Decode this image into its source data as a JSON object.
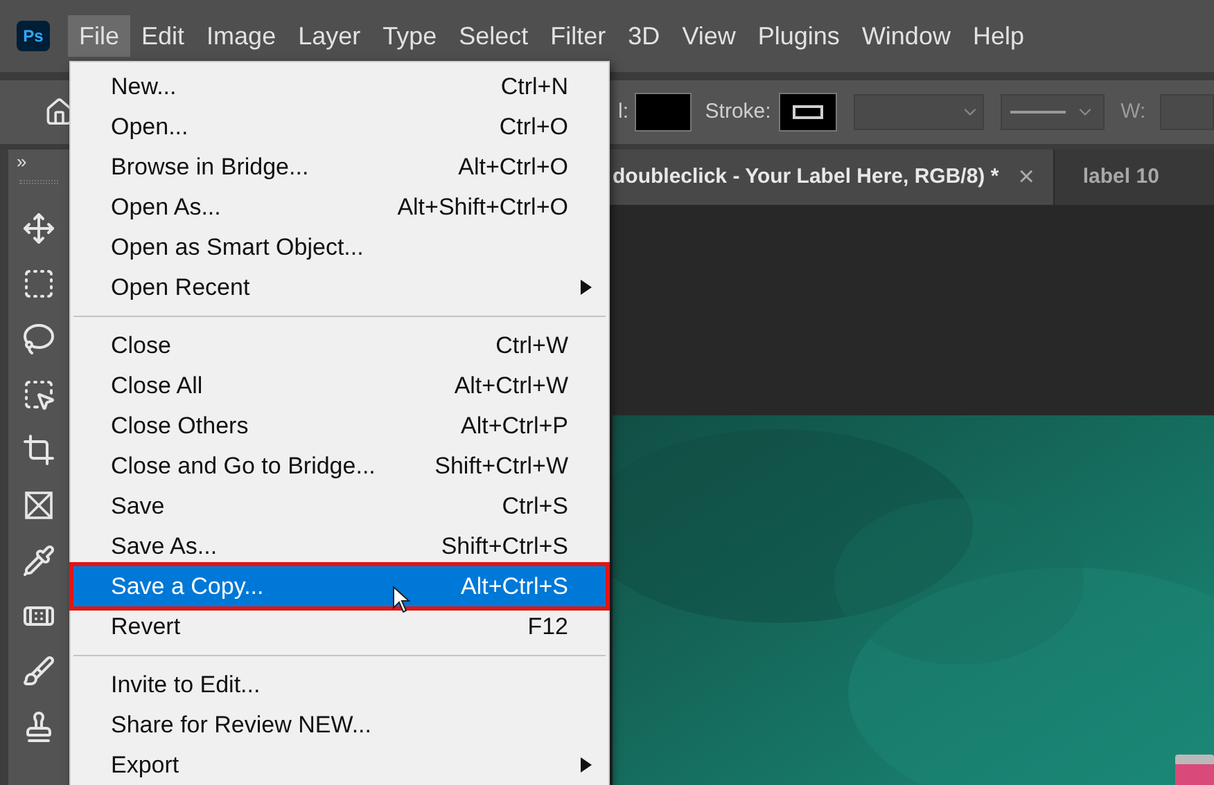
{
  "app_logo": "Ps",
  "menu_bar": [
    {
      "label": "File",
      "selected": true
    },
    {
      "label": "Edit",
      "selected": false
    },
    {
      "label": "Image",
      "selected": false
    },
    {
      "label": "Layer",
      "selected": false
    },
    {
      "label": "Type",
      "selected": false
    },
    {
      "label": "Select",
      "selected": false
    },
    {
      "label": "Filter",
      "selected": false
    },
    {
      "label": "3D",
      "selected": false
    },
    {
      "label": "View",
      "selected": false
    },
    {
      "label": "Plugins",
      "selected": false
    },
    {
      "label": "Window",
      "selected": false
    },
    {
      "label": "Help",
      "selected": false
    }
  ],
  "options_bar": {
    "fill_label": "l:",
    "stroke_label": "Stroke:",
    "width_label": "W:"
  },
  "panel_toggle": "»",
  "tabs": [
    {
      "label": "doubleclick - Your Label Here, RGB/8) *",
      "selected": true,
      "close": "×"
    },
    {
      "label": "label 10",
      "selected": false
    }
  ],
  "file_menu": [
    {
      "kind": "item",
      "label": "New...",
      "shortcut": "Ctrl+N",
      "selected": false
    },
    {
      "kind": "item",
      "label": "Open...",
      "shortcut": "Ctrl+O",
      "selected": false
    },
    {
      "kind": "item",
      "label": "Browse in Bridge...",
      "shortcut": "Alt+Ctrl+O",
      "selected": false
    },
    {
      "kind": "item",
      "label": "Open As...",
      "shortcut": "Alt+Shift+Ctrl+O",
      "selected": false
    },
    {
      "kind": "item",
      "label": "Open as Smart Object...",
      "selected": false
    },
    {
      "kind": "submenu",
      "label": "Open Recent",
      "selected": false
    },
    {
      "kind": "separator"
    },
    {
      "kind": "item",
      "label": "Close",
      "shortcut": "Ctrl+W",
      "selected": false
    },
    {
      "kind": "item",
      "label": "Close All",
      "shortcut": "Alt+Ctrl+W",
      "selected": false
    },
    {
      "kind": "item",
      "label": "Close Others",
      "shortcut": "Alt+Ctrl+P",
      "selected": false
    },
    {
      "kind": "item",
      "label": "Close and Go to Bridge...",
      "shortcut": "Shift+Ctrl+W",
      "selected": false
    },
    {
      "kind": "item",
      "label": "Save",
      "shortcut": "Ctrl+S",
      "selected": false
    },
    {
      "kind": "item",
      "label": "Save As...",
      "shortcut": "Shift+Ctrl+S",
      "selected": false
    },
    {
      "kind": "item",
      "label": "Save a Copy...",
      "shortcut": "Alt+Ctrl+S",
      "selected": true
    },
    {
      "kind": "item",
      "label": "Revert",
      "shortcut": "F12",
      "selected": false
    },
    {
      "kind": "separator"
    },
    {
      "kind": "item",
      "label": "Invite to Edit...",
      "selected": false
    },
    {
      "kind": "item",
      "label": "Share for Review NEW...",
      "selected": false
    },
    {
      "kind": "submenu",
      "label": "Export",
      "selected": false
    }
  ]
}
